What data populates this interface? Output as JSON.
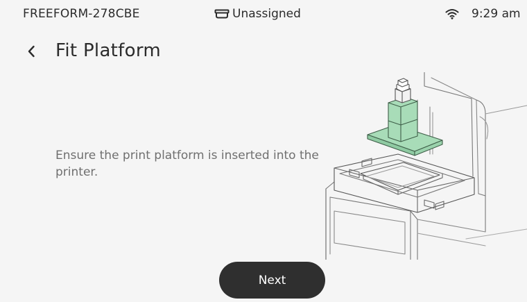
{
  "status_bar": {
    "device_name": "FREEFORM-278CBE",
    "tank_status": "Unassigned",
    "time": "9:29 am",
    "tank_icon": "resin-tank-icon",
    "wifi_icon": "wifi-icon"
  },
  "header": {
    "title": "Fit Platform",
    "back_icon": "chevron-left-icon"
  },
  "main": {
    "instruction": "Ensure the print platform is inserted into the printer.",
    "illustration": "printer-with-build-platform-illustration",
    "highlight_color": "#a8dcb8"
  },
  "footer": {
    "next_label": "Next"
  }
}
